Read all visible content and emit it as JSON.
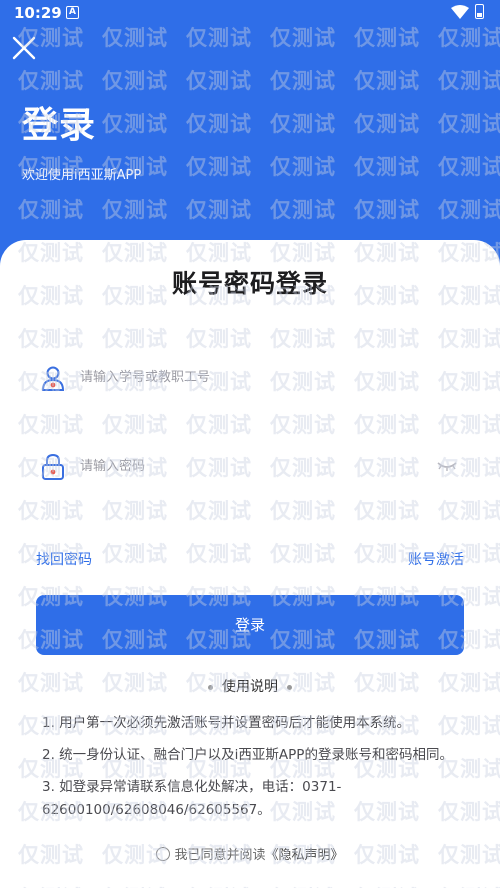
{
  "status_bar": {
    "time": "10:29",
    "notification_letter": "A"
  },
  "header": {
    "title": "登录",
    "subtitle": "欢迎使用i西亚斯APP"
  },
  "watermark": {
    "text": "仅测试"
  },
  "card": {
    "title": "账号密码登录",
    "username": {
      "placeholder": "请输入学号或教职工号",
      "icon": "user-icon"
    },
    "password": {
      "placeholder": "请输入密码",
      "icon": "lock-icon",
      "toggle_icon": "eye-closed-icon"
    },
    "forgot_label": "找回密码",
    "activate_label": "账号激活",
    "login_label": "登录",
    "usage_title": "使用说明",
    "notes": [
      "1. 用户第一次必须先激活账号并设置密码后才能使用本系统。",
      "2. 统一身份认证、融合门户以及i西亚斯APP的登录账号和密码相同。",
      "3. 如登录异常请联系信息化处解决，电话：0371-62600100/62608046/62605567。"
    ],
    "agree_text": "我已同意并阅读",
    "privacy_label": "《隐私声明》"
  },
  "colors": {
    "primary": "#2f6ee8",
    "card_bg": "#ffffff",
    "watermark": "#c8d0e1"
  }
}
